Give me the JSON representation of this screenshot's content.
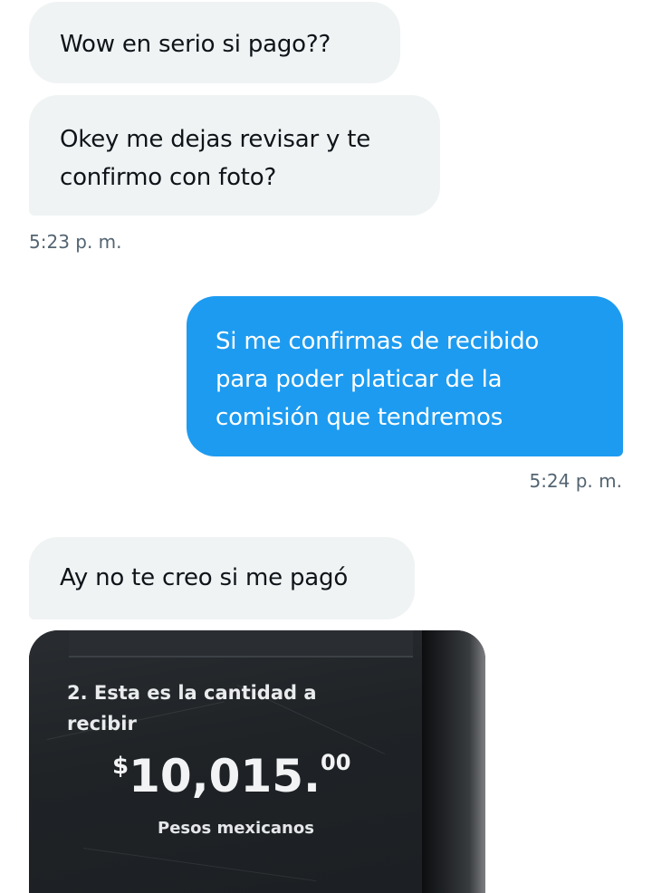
{
  "messages": [
    {
      "id": "msg1",
      "direction": "incoming",
      "text": "Wow en serio si pago??"
    },
    {
      "id": "msg2",
      "direction": "incoming",
      "text": "Okey me dejas revisar y te confirmo con foto?"
    },
    {
      "id": "msg3",
      "direction": "outgoing",
      "text": "Si me confirmas de recibido para poder platicar de la comisión que tendremos"
    },
    {
      "id": "msg4",
      "direction": "incoming",
      "text": "Ay no te creo si me pagó"
    }
  ],
  "timestamps": {
    "incoming_group_1": "5:23 p. m.",
    "outgoing_group_1": "5:24 p. m."
  },
  "photo": {
    "step_text": "2. Esta es la cantidad a recibir",
    "currency_symbol": "$",
    "amount_integer": "10,015.",
    "amount_decimals": "00",
    "currency_name": "Pesos mexicanos"
  },
  "colors": {
    "incoming_bubble": "#eff3f4",
    "outgoing_bubble": "#1d9bf0",
    "timestamp": "#536471"
  }
}
